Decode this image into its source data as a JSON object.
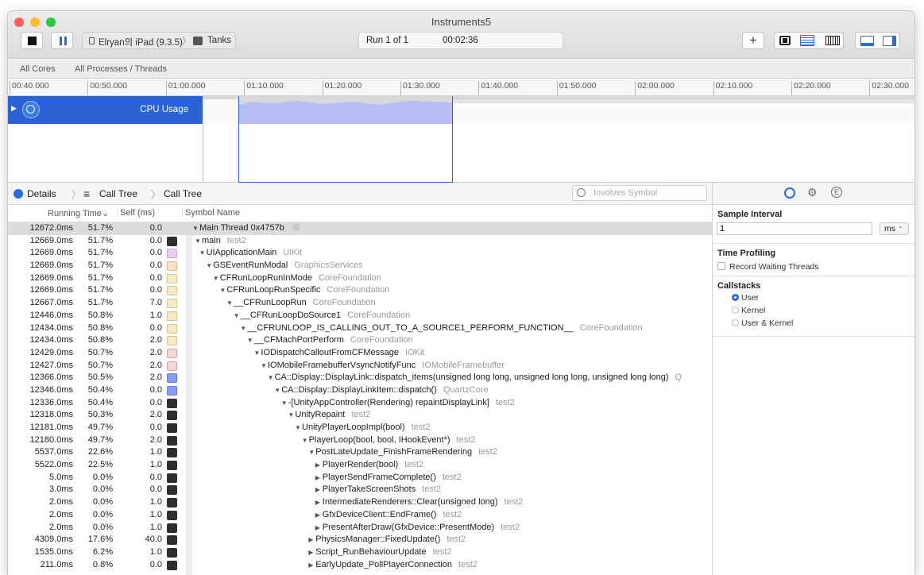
{
  "window": {
    "title": "Instruments5"
  },
  "toolbar": {
    "device_label": "Elryan의 iPad (9.3.5)",
    "target_label": "Tanks",
    "run_label": "Run 1 of 1",
    "elapsed": "00:02:36",
    "plus_label": "+"
  },
  "filter": {
    "cores": "All Cores",
    "processes": "All Processes / Threads"
  },
  "ruler": {
    "ticks": [
      "00:40.000",
      "00:50.000",
      "01:00.000",
      "01:10.000",
      "01:20.000",
      "01:30.000",
      "01:40.000",
      "01:50.000",
      "02:00.000",
      "02:10.000",
      "02:20.000",
      "02:30.000"
    ]
  },
  "track": {
    "label": "CPU Usage",
    "disclosure": "▶"
  },
  "details": {
    "tab_details": "Details",
    "crumb1": "Call Tree",
    "crumb2": "Call Tree",
    "search_placeholder": "Involves Symbol"
  },
  "columns": {
    "running": "Running Time",
    "self": "Self (ms)",
    "symbol": "Symbol Name"
  },
  "colors": {
    "accent": "#2b63d4",
    "lib": "#9a9a9a",
    "selection": "#dcdcdc",
    "user_icon": "#3a3a3a",
    "lib_icon": "#e9c6df",
    "quartz_icon": "#7f8ee8"
  },
  "rows": [
    {
      "running": "12672.0ms",
      "pct": "51.7%",
      "self": "0.0",
      "icon": "none",
      "depth": 0,
      "disc": "▼",
      "symbol": "Main Thread  0x4757b",
      "library": "",
      "sel": true
    },
    {
      "running": "12669.0ms",
      "pct": "51.7%",
      "self": "0.0",
      "icon": "user-icon",
      "depth": 0,
      "disc": "▼",
      "symbol": "main",
      "library": "test2"
    },
    {
      "running": "12669.0ms",
      "pct": "51.7%",
      "self": "0.0",
      "icon": "uikit-icon",
      "depth": 1,
      "disc": "▼",
      "symbol": "UIApplicationMain",
      "library": "UIKit"
    },
    {
      "running": "12669.0ms",
      "pct": "51.7%",
      "self": "0.0",
      "icon": "gs-icon",
      "depth": 2,
      "disc": "▼",
      "symbol": "GSEventRunModal",
      "library": "GraphicsServices"
    },
    {
      "running": "12669.0ms",
      "pct": "51.7%",
      "self": "0.0",
      "icon": "cf-icon",
      "depth": 3,
      "disc": "▼",
      "symbol": "CFRunLoopRunInMode",
      "library": "CoreFoundation"
    },
    {
      "running": "12669.0ms",
      "pct": "51.7%",
      "self": "0.0",
      "icon": "cf-icon",
      "depth": 4,
      "disc": "▼",
      "symbol": "CFRunLoopRunSpecific",
      "library": "CoreFoundation"
    },
    {
      "running": "12667.0ms",
      "pct": "51.7%",
      "self": "7.0",
      "icon": "cf-icon",
      "depth": 5,
      "disc": "▼",
      "symbol": "__CFRunLoopRun",
      "library": "CoreFoundation"
    },
    {
      "running": "12446.0ms",
      "pct": "50.8%",
      "self": "1.0",
      "icon": "cf-icon",
      "depth": 6,
      "disc": "▼",
      "symbol": "__CFRunLoopDoSource1",
      "library": "CoreFoundation"
    },
    {
      "running": "12434.0ms",
      "pct": "50.8%",
      "self": "0.0",
      "icon": "cf-icon",
      "depth": 7,
      "disc": "▼",
      "symbol": "__CFRUNLOOP_IS_CALLING_OUT_TO_A_SOURCE1_PERFORM_FUNCTION__",
      "library": "CoreFoundation"
    },
    {
      "running": "12434.0ms",
      "pct": "50.8%",
      "self": "2.0",
      "icon": "cf-icon",
      "depth": 8,
      "disc": "▼",
      "symbol": "__CFMachPortPerform",
      "library": "CoreFoundation"
    },
    {
      "running": "12429.0ms",
      "pct": "50.7%",
      "self": "2.0",
      "icon": "iokit-icon",
      "depth": 9,
      "disc": "▼",
      "symbol": "IODispatchCalloutFromCFMessage",
      "library": "IOKit"
    },
    {
      "running": "12427.0ms",
      "pct": "50.7%",
      "self": "2.0",
      "icon": "iokit-icon",
      "depth": 10,
      "disc": "▼",
      "symbol": "IOMobileFramebufferVsyncNotifyFunc",
      "library": "IOMobileFramebuffer"
    },
    {
      "running": "12366.0ms",
      "pct": "50.5%",
      "self": "2.0",
      "icon": "quartz-icon",
      "depth": 11,
      "disc": "▼",
      "symbol": "CA::Display::DisplayLink::dispatch_items(unsigned long long, unsigned long long, unsigned long long)",
      "library": "Q"
    },
    {
      "running": "12346.0ms",
      "pct": "50.4%",
      "self": "0.0",
      "icon": "quartz-icon",
      "depth": 12,
      "disc": "▼",
      "symbol": "CA::Display::DisplayLinkItem::dispatch()",
      "library": "QuartzCore"
    },
    {
      "running": "12336.0ms",
      "pct": "50.4%",
      "self": "0.0",
      "icon": "user-icon",
      "depth": 13,
      "disc": "▼",
      "symbol": "-[UnityAppController(Rendering) repaintDisplayLink]",
      "library": "test2"
    },
    {
      "running": "12318.0ms",
      "pct": "50.3%",
      "self": "2.0",
      "icon": "user-icon",
      "depth": 14,
      "disc": "▼",
      "symbol": "UnityRepaint",
      "library": "test2"
    },
    {
      "running": "12181.0ms",
      "pct": "49.7%",
      "self": "0.0",
      "icon": "user-icon",
      "depth": 15,
      "disc": "▼",
      "symbol": "UnityPlayerLoopImpl(bool)",
      "library": "test2"
    },
    {
      "running": "12180.0ms",
      "pct": "49.7%",
      "self": "2.0",
      "icon": "user-icon",
      "depth": 16,
      "disc": "▼",
      "symbol": "PlayerLoop(bool, bool, IHookEvent*)",
      "library": "test2"
    },
    {
      "running": "5537.0ms",
      "pct": "22.6%",
      "self": "1.0",
      "icon": "user-icon",
      "depth": 17,
      "disc": "▼",
      "symbol": "PostLateUpdate_FinishFrameRendering",
      "library": "test2"
    },
    {
      "running": "5522.0ms",
      "pct": "22.5%",
      "self": "1.0",
      "icon": "user-icon",
      "depth": 18,
      "disc": "▶",
      "symbol": "PlayerRender(bool)",
      "library": "test2"
    },
    {
      "running": "5.0ms",
      "pct": "0.0%",
      "self": "0.0",
      "icon": "user-icon",
      "depth": 18,
      "disc": "▶",
      "symbol": "PlayerSendFrameComplete()",
      "library": "test2"
    },
    {
      "running": "3.0ms",
      "pct": "0.0%",
      "self": "0.0",
      "icon": "user-icon",
      "depth": 18,
      "disc": "▶",
      "symbol": "PlayerTakeScreenShots",
      "library": "test2"
    },
    {
      "running": "2.0ms",
      "pct": "0.0%",
      "self": "1.0",
      "icon": "user-icon",
      "depth": 18,
      "disc": "▶",
      "symbol": "IntermediateRenderers::Clear(unsigned long)",
      "library": "test2"
    },
    {
      "running": "2.0ms",
      "pct": "0.0%",
      "self": "1.0",
      "icon": "user-icon",
      "depth": 18,
      "disc": "▶",
      "symbol": "GfxDeviceClient::EndFrame()",
      "library": "test2"
    },
    {
      "running": "2.0ms",
      "pct": "0.0%",
      "self": "1.0",
      "icon": "user-icon",
      "depth": 18,
      "disc": "▶",
      "symbol": "PresentAfterDraw(GfxDevice::PresentMode)",
      "library": "test2"
    },
    {
      "running": "4309.0ms",
      "pct": "17.6%",
      "self": "40.0",
      "icon": "user-icon",
      "depth": 17,
      "disc": "▶",
      "symbol": "PhysicsManager::FixedUpdate()",
      "library": "test2"
    },
    {
      "running": "1535.0ms",
      "pct": "6.2%",
      "self": "1.0",
      "icon": "user-icon",
      "depth": 17,
      "disc": "▶",
      "symbol": "Script_RunBehaviourUpdate",
      "library": "test2"
    },
    {
      "running": "211.0ms",
      "pct": "0.8%",
      "self": "0.0",
      "icon": "user-icon",
      "depth": 17,
      "disc": "▶",
      "symbol": "EarlyUpdate_PollPlayerConnection",
      "library": "test2"
    }
  ],
  "inspector": {
    "sample_interval_title": "Sample Interval",
    "sample_interval_value": "1",
    "unit": "ms",
    "time_profiling_title": "Time Profiling",
    "record_waiting": "Record Waiting Threads",
    "callstacks_title": "Callstacks",
    "options": [
      {
        "label": "User",
        "selected": true
      },
      {
        "label": "Kernel",
        "selected": false
      },
      {
        "label": "User & Kernel",
        "selected": false
      }
    ]
  }
}
